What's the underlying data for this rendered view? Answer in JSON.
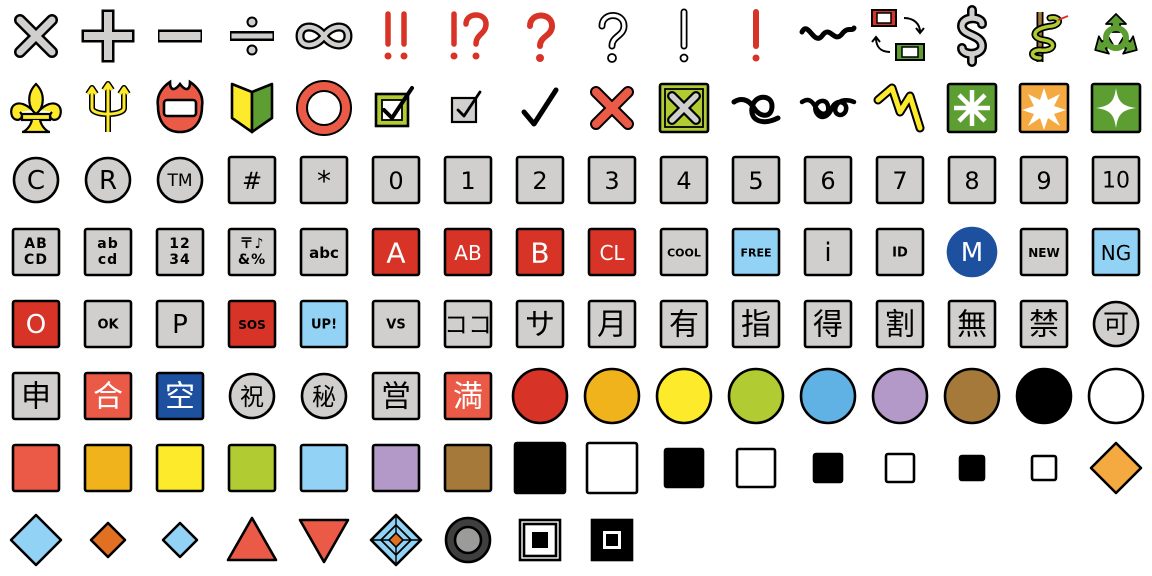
{
  "palette": {
    "red": "#d73327",
    "coral": "#ea5a47",
    "orange": "#f1b31c",
    "orange2": "#f4aa41",
    "yellow": "#fcea2b",
    "green": "#b1cc33",
    "green2": "#5c9e31",
    "blue": "#61b2e4",
    "lightblue": "#92d3f5",
    "purple": "#b399c8",
    "brown": "#a57939",
    "gray": "#d0cfce",
    "navy": "#1e50a0",
    "darkorange": "#e27022",
    "black": "#000000",
    "white": "#ffffff"
  },
  "emojis": [
    {
      "icon": "multiply-icon"
    },
    {
      "icon": "plus-icon"
    },
    {
      "icon": "minus-icon"
    },
    {
      "icon": "divide-icon"
    },
    {
      "icon": "infinity-icon"
    },
    {
      "icon": "double-exclamation-icon",
      "text": "!!"
    },
    {
      "icon": "exclamation-question-icon",
      "text": "!?"
    },
    {
      "icon": "red-question-icon",
      "text": "?"
    },
    {
      "icon": "white-question-icon",
      "text": "?"
    },
    {
      "icon": "white-exclamation-icon",
      "text": "!"
    },
    {
      "icon": "red-exclamation-icon",
      "text": "!"
    },
    {
      "icon": "wavy-dash-icon"
    },
    {
      "icon": "currency-exchange-icon"
    },
    {
      "icon": "dollar-sign-icon",
      "text": "$"
    },
    {
      "icon": "medical-symbol-icon"
    },
    {
      "icon": "recycling-icon"
    },
    {
      "icon": "fleur-de-lis-icon"
    },
    {
      "icon": "trident-icon"
    },
    {
      "icon": "name-badge-icon"
    },
    {
      "icon": "beginner-icon"
    },
    {
      "icon": "hollow-red-circle-icon"
    },
    {
      "icon": "check-box-green-icon"
    },
    {
      "icon": "check-box-gray-icon"
    },
    {
      "icon": "check-mark-icon"
    },
    {
      "icon": "cross-mark-icon"
    },
    {
      "icon": "cross-mark-button-icon"
    },
    {
      "icon": "curly-loop-icon"
    },
    {
      "icon": "double-curly-loop-icon"
    },
    {
      "icon": "part-alternation-mark-icon"
    },
    {
      "icon": "eight-spoked-asterisk-icon"
    },
    {
      "icon": "eight-pointed-star-icon"
    },
    {
      "icon": "sparkle-icon"
    },
    {
      "icon": "copyright-icon",
      "text": "C"
    },
    {
      "icon": "registered-icon",
      "text": "R"
    },
    {
      "icon": "trade-mark-icon",
      "text": "TM"
    },
    {
      "icon": "keycap-hash-icon",
      "text": "#"
    },
    {
      "icon": "keycap-asterisk-icon",
      "text": "*"
    },
    {
      "icon": "keycap-0-icon",
      "text": "0"
    },
    {
      "icon": "keycap-1-icon",
      "text": "1"
    },
    {
      "icon": "keycap-2-icon",
      "text": "2"
    },
    {
      "icon": "keycap-3-icon",
      "text": "3"
    },
    {
      "icon": "keycap-4-icon",
      "text": "4"
    },
    {
      "icon": "keycap-5-icon",
      "text": "5"
    },
    {
      "icon": "keycap-6-icon",
      "text": "6"
    },
    {
      "icon": "keycap-7-icon",
      "text": "7"
    },
    {
      "icon": "keycap-8-icon",
      "text": "8"
    },
    {
      "icon": "keycap-9-icon",
      "text": "9"
    },
    {
      "icon": "keycap-10-icon",
      "text": "10"
    },
    {
      "icon": "input-latin-uppercase-icon",
      "text": "AB",
      "text2": "CD"
    },
    {
      "icon": "input-latin-lowercase-icon",
      "text": "ab",
      "text2": "cd"
    },
    {
      "icon": "input-numbers-icon",
      "text": "12",
      "text2": "34"
    },
    {
      "icon": "input-symbols-icon",
      "text": "〒♪",
      "text2": "&%"
    },
    {
      "icon": "input-latin-letters-icon",
      "text": "abc"
    },
    {
      "icon": "a-button-icon",
      "text": "A"
    },
    {
      "icon": "ab-button-icon",
      "text": "AB"
    },
    {
      "icon": "b-button-icon",
      "text": "B"
    },
    {
      "icon": "cl-button-icon",
      "text": "CL"
    },
    {
      "icon": "cool-button-icon",
      "text": "COOL"
    },
    {
      "icon": "free-button-icon",
      "text": "FREE"
    },
    {
      "icon": "information-icon",
      "text": "i"
    },
    {
      "icon": "id-button-icon",
      "text": "ID"
    },
    {
      "icon": "circled-m-icon",
      "text": "M"
    },
    {
      "icon": "new-button-icon",
      "text": "NEW"
    },
    {
      "icon": "ng-button-icon",
      "text": "NG"
    },
    {
      "icon": "o-button-icon",
      "text": "O"
    },
    {
      "icon": "ok-button-icon",
      "text": "OK"
    },
    {
      "icon": "p-button-icon",
      "text": "P"
    },
    {
      "icon": "sos-button-icon",
      "text": "SOS"
    },
    {
      "icon": "up-button-icon",
      "text": "UP!"
    },
    {
      "icon": "vs-button-icon",
      "text": "VS"
    },
    {
      "icon": "japanese-here-icon",
      "text": "ココ"
    },
    {
      "icon": "japanese-service-charge-icon",
      "text": "サ"
    },
    {
      "icon": "japanese-monthly-amount-icon",
      "text": "月"
    },
    {
      "icon": "japanese-not-free-icon",
      "text": "有"
    },
    {
      "icon": "japanese-reserved-icon",
      "text": "指"
    },
    {
      "icon": "japanese-bargain-icon",
      "text": "得"
    },
    {
      "icon": "japanese-discount-icon",
      "text": "割"
    },
    {
      "icon": "japanese-free-of-charge-icon",
      "text": "無"
    },
    {
      "icon": "japanese-prohibited-icon",
      "text": "禁"
    },
    {
      "icon": "japanese-acceptable-icon",
      "text": "可"
    },
    {
      "icon": "japanese-application-icon",
      "text": "申"
    },
    {
      "icon": "japanese-passing-grade-icon",
      "text": "合"
    },
    {
      "icon": "japanese-vacancy-icon",
      "text": "空"
    },
    {
      "icon": "japanese-congratulations-icon",
      "text": "祝"
    },
    {
      "icon": "japanese-secret-icon",
      "text": "秘"
    },
    {
      "icon": "japanese-open-for-business-icon",
      "text": "営"
    },
    {
      "icon": "japanese-no-vacancy-icon",
      "text": "満"
    },
    {
      "icon": "red-circle-icon"
    },
    {
      "icon": "orange-circle-icon"
    },
    {
      "icon": "yellow-circle-icon"
    },
    {
      "icon": "green-circle-icon"
    },
    {
      "icon": "blue-circle-icon"
    },
    {
      "icon": "purple-circle-icon"
    },
    {
      "icon": "brown-circle-icon"
    },
    {
      "icon": "black-circle-icon"
    },
    {
      "icon": "white-circle-icon"
    },
    {
      "icon": "red-square-icon"
    },
    {
      "icon": "orange-square-icon"
    },
    {
      "icon": "yellow-square-icon"
    },
    {
      "icon": "green-square-icon"
    },
    {
      "icon": "blue-square-icon"
    },
    {
      "icon": "purple-square-icon"
    },
    {
      "icon": "brown-square-icon"
    },
    {
      "icon": "black-large-square-icon"
    },
    {
      "icon": "white-large-square-icon"
    },
    {
      "icon": "black-medium-square-icon"
    },
    {
      "icon": "white-medium-square-icon"
    },
    {
      "icon": "black-medium-small-square-icon"
    },
    {
      "icon": "white-medium-small-square-icon"
    },
    {
      "icon": "black-small-square-icon"
    },
    {
      "icon": "white-small-square-icon"
    },
    {
      "icon": "large-orange-diamond-icon"
    },
    {
      "icon": "large-blue-diamond-icon"
    },
    {
      "icon": "small-orange-diamond-icon"
    },
    {
      "icon": "small-blue-diamond-icon"
    },
    {
      "icon": "red-triangle-up-icon"
    },
    {
      "icon": "red-triangle-down-icon"
    },
    {
      "icon": "diamond-with-a-dot-icon"
    },
    {
      "icon": "radio-button-icon"
    },
    {
      "icon": "white-square-button-icon"
    },
    {
      "icon": "black-square-button-icon"
    }
  ]
}
